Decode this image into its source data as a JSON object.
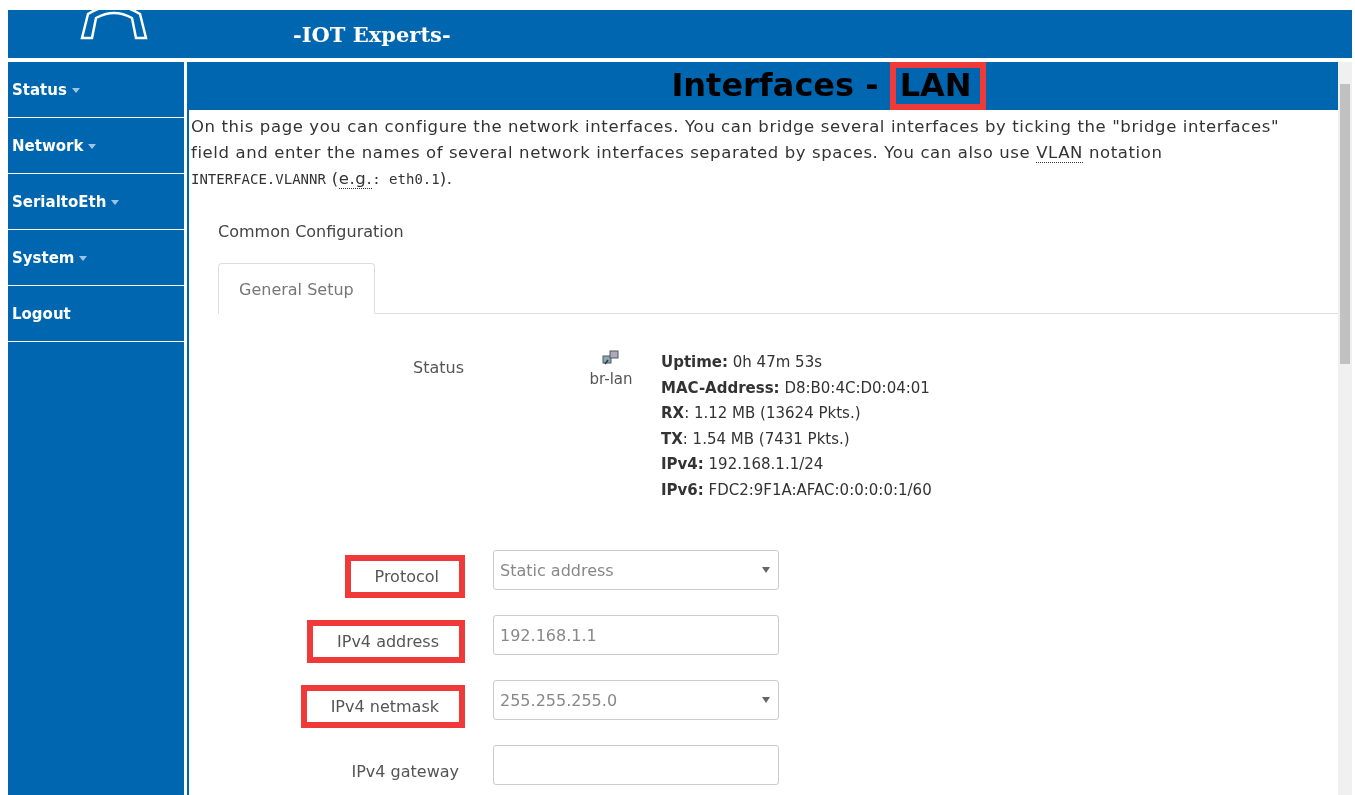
{
  "header": {
    "title": "-IOT Experts-"
  },
  "sidebar": {
    "items": [
      {
        "label": "Status",
        "has_menu": true
      },
      {
        "label": "Network",
        "has_menu": true
      },
      {
        "label": "SerialtoEth",
        "has_menu": true
      },
      {
        "label": "System",
        "has_menu": true
      },
      {
        "label": "Logout",
        "has_menu": false
      }
    ]
  },
  "page": {
    "title": "Interfaces - ",
    "title_highlight": "LAN",
    "title_highlighted": true,
    "description": [
      {
        "kind": "text",
        "text": "On this page you can configure the network interfaces. You can bridge several interfaces by ticking the \"bridge interfaces\" field and enter the names of several network interfaces separated by spaces. You can also use "
      },
      {
        "kind": "abbr",
        "text": "VLAN"
      },
      {
        "kind": "text",
        "text": " notation "
      },
      {
        "kind": "code",
        "text": "INTERFACE.VLANNR"
      },
      {
        "kind": "text",
        "text": " ("
      },
      {
        "kind": "abbr",
        "text": "e.g."
      },
      {
        "kind": "code",
        "text": ": eth0.1"
      },
      {
        "kind": "text",
        "text": ")."
      }
    ],
    "section": "Common Configuration",
    "tabs": [
      {
        "label": "General Setup",
        "selected": true
      }
    ],
    "status": {
      "label": "Status",
      "device": "br-lan",
      "lines": [
        "**Uptime:** 0h 47m 53s",
        "**MAC-Address:** D8:B0:4C:D0:04:01",
        "**RX**: 1.12 MB (13624 Pkts.)",
        "**TX**: 1.54 MB (7431 Pkts.)",
        "**IPv4:** 192.168.1.1/24",
        "**IPv6:** FDC2:9F1A:AFAC:0:0:0:0:1/60"
      ]
    },
    "fields": [
      {
        "label": "Protocol",
        "kind": "select",
        "value": "Static address",
        "highlighted": true
      },
      {
        "label": "IPv4 address",
        "kind": "input",
        "value": "192.168.1.1",
        "highlighted": true
      },
      {
        "label": "IPv4 netmask",
        "kind": "select",
        "value": "255.255.255.0",
        "highlighted": true
      },
      {
        "label": "IPv4 gateway",
        "kind": "input",
        "highlighted": false
      }
    ]
  }
}
